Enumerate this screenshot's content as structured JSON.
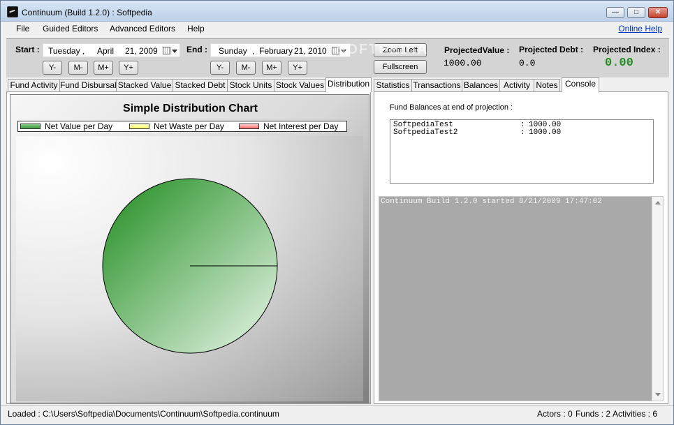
{
  "window": {
    "title": "Continuum (Build 1.2.0) : Softpedia"
  },
  "menu": {
    "items": [
      "File",
      "Guided Editors",
      "Advanced Editors",
      "Help"
    ],
    "online_help": "Online Help"
  },
  "toolbar": {
    "start_label": "Start :",
    "start_day": "Tuesday",
    "start_comma": ",",
    "start_month": "April",
    "start_date": "21, 2009",
    "end_label": "End :",
    "end_day": "Sunday",
    "end_comma": ",",
    "end_month": "February",
    "end_date": "21, 2010",
    "nav_buttons": [
      "Y-",
      "M-",
      "M+",
      "Y+"
    ],
    "zoom_left": "Zoom Left",
    "fullscreen": "Fullscreen",
    "projected_value_label": "ProjectedValue :",
    "projected_value": "1000.00",
    "projected_debt_label": "Projected Debt :",
    "projected_debt": "0.0",
    "projected_index_label": "Projected Index :",
    "projected_index": "0.00",
    "watermark": "SOFTPEDIA"
  },
  "left_tabs": [
    "Fund Activity",
    "Fund Disbursal",
    "Stacked Value",
    "Stacked Debt",
    "Stock Units",
    "Stock Values",
    "Distribution"
  ],
  "right_tabs": [
    "Statistics",
    "Transactions",
    "Balances",
    "Activity",
    "Notes",
    "Console"
  ],
  "chart_data": {
    "type": "pie",
    "title": "Simple Distribution Chart",
    "categories": [
      "Net Value per Day",
      "Net Waste per Day",
      "Net Interest per Day"
    ],
    "values": [
      100,
      0,
      0
    ],
    "colors": [
      "#3d9b3d",
      "#ffff66",
      "#ff6b6b"
    ],
    "legend": "top-left"
  },
  "balances": {
    "heading": "Fund Balances at end of projection :",
    "rows": [
      {
        "name": "SoftpediaTest",
        "sep": ":",
        "value": "1000.00"
      },
      {
        "name": "SoftpediaTest2",
        "sep": ":",
        "value": "1000.00"
      }
    ]
  },
  "console": {
    "log": "Continuum Build 1.2.0 started 8/21/2009 17:47:02"
  },
  "status": {
    "loaded": "Loaded : C:\\Users\\Softpedia\\Documents\\Continuum\\Softpedia.continuum",
    "actors": "Actors : 0",
    "funds": "Funds : 2",
    "activities": "Activities : 6"
  },
  "colors": {
    "accent_green": "#228b22",
    "link_blue": "#0033cc",
    "console_bg": "#a9a9a9"
  }
}
